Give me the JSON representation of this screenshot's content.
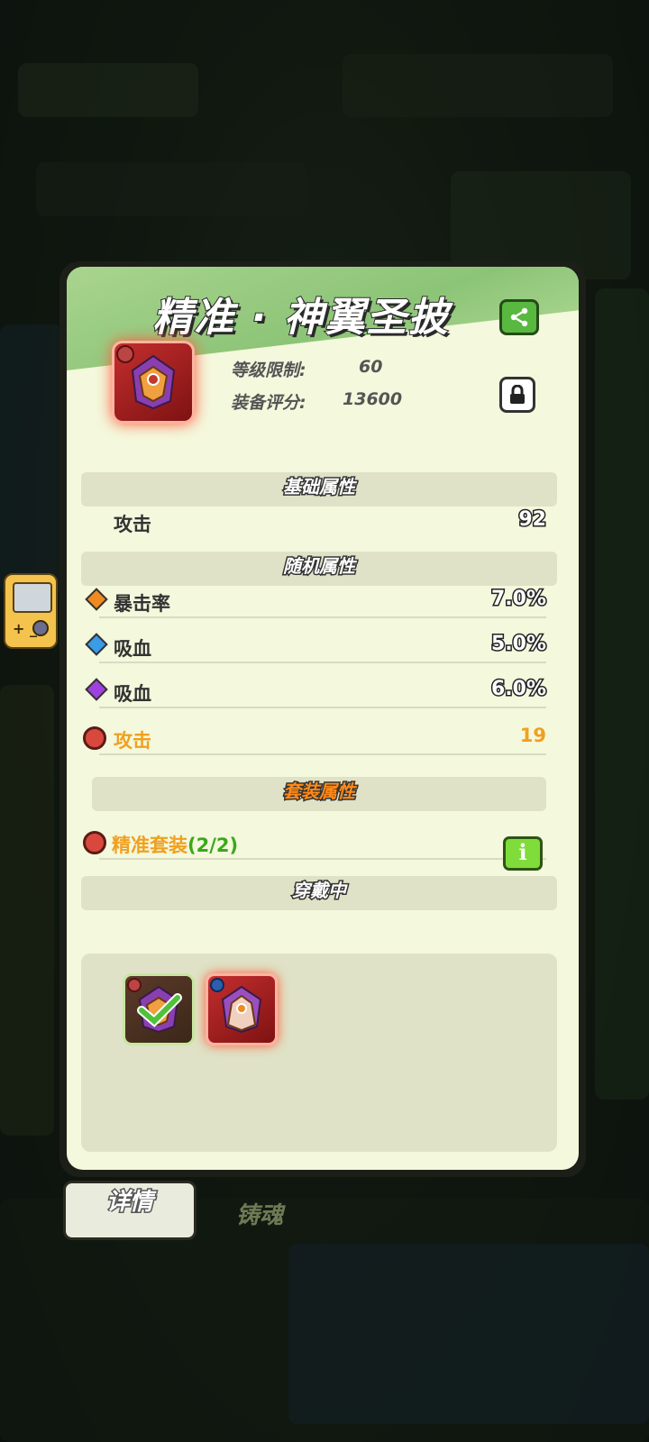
{
  "item": {
    "title": "精准 · 神翼圣披",
    "level_label": "等级限制:",
    "level_value": "60",
    "score_label": "装备评分:",
    "score_value": "13600"
  },
  "sections": {
    "base": "基础属性",
    "random": "随机属性",
    "set": "套装属性",
    "wearing": "穿戴中"
  },
  "base_stats": [
    {
      "label": "攻击",
      "value": "92"
    }
  ],
  "random_stats": [
    {
      "label": "暴击率",
      "value": "7.0%",
      "gem_color": "#f08a20"
    },
    {
      "label": "吸血",
      "value": "5.0%",
      "gem_color": "#3a9be6"
    },
    {
      "label": "吸血",
      "value": "6.0%",
      "gem_color": "#a040e0"
    }
  ],
  "bonus_stat": {
    "label": "攻击",
    "value": "19",
    "color": "#f0a020"
  },
  "set_bonus": {
    "label": "精准套装",
    "count": "(2/2)",
    "label_color": "#f0a020",
    "count_color": "#3aa81a"
  },
  "set_info_glyph": "i",
  "tabs": {
    "details": "详情",
    "forge": "铸魂"
  },
  "icons": {
    "share": "share-icon",
    "lock": "lock-icon",
    "set": "target-icon"
  }
}
